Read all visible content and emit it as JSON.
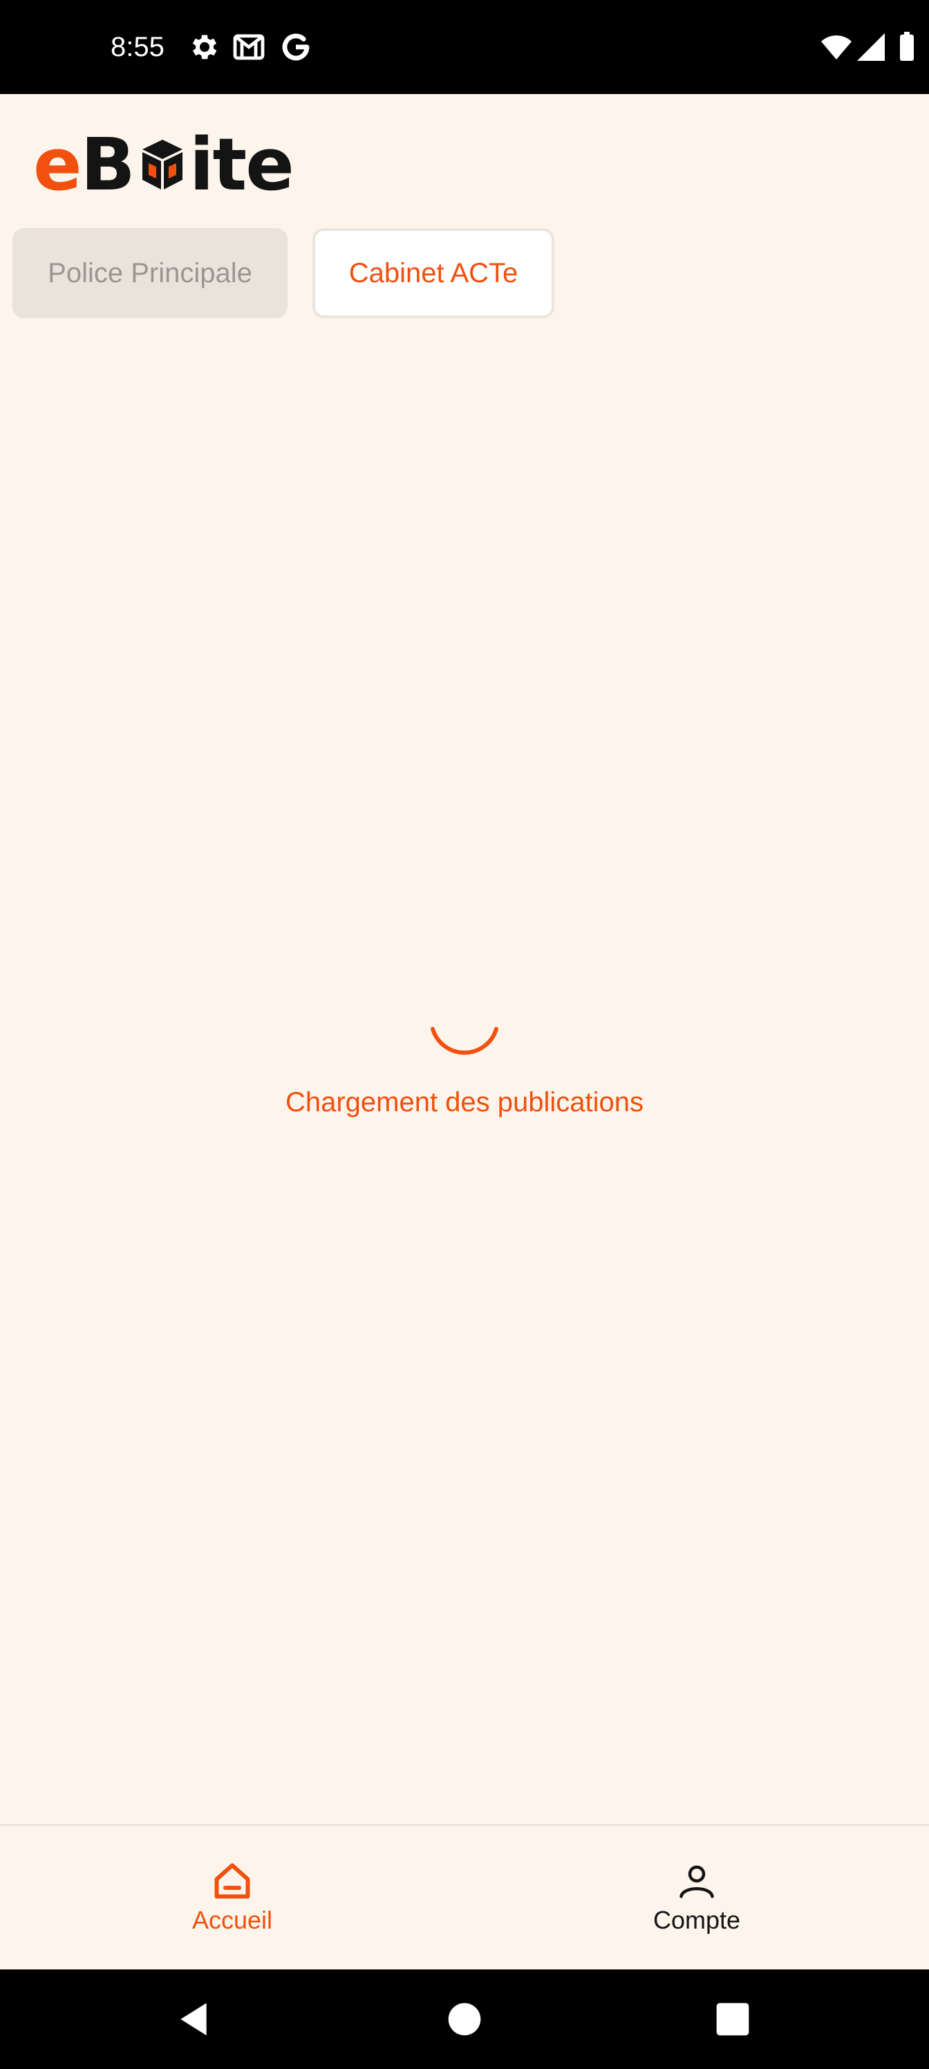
{
  "status_bar": {
    "time": "8:55",
    "left_icons": [
      "settings-gear-icon",
      "gmail-icon",
      "google-g-icon"
    ],
    "right_icons": [
      "wifi-icon",
      "cell-signal-icon",
      "battery-icon"
    ]
  },
  "app": {
    "logo": "eBoite",
    "brand_color": "#F1500F",
    "background_color": "#FDF5EC"
  },
  "tabs": [
    {
      "label": "Police Principale",
      "selected": false
    },
    {
      "label": "Cabinet ACTe",
      "selected": true
    }
  ],
  "loading": {
    "message": "Chargement des publications",
    "icon": "spinner-icon"
  },
  "bottom_nav": {
    "items": [
      {
        "label": "Accueil",
        "icon": "home-icon",
        "active": true
      },
      {
        "label": "Compte",
        "icon": "user-icon",
        "active": false
      }
    ]
  },
  "system_nav": {
    "buttons": [
      "back-icon",
      "home-circle-icon",
      "recents-square-icon"
    ]
  }
}
